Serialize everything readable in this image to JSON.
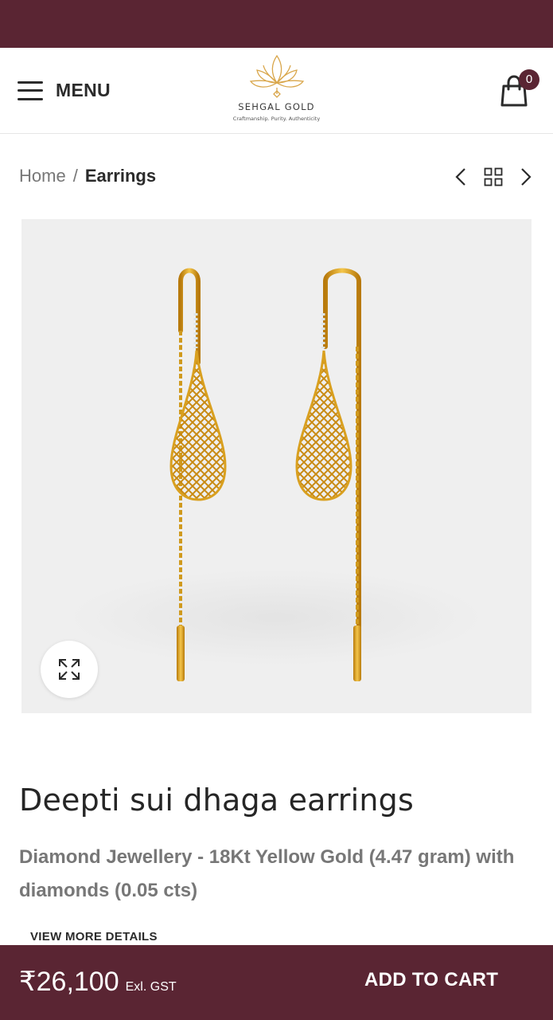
{
  "header": {
    "menu_label": "MENU",
    "logo_name": "SEHGAL GOLD",
    "logo_tagline": "Craftmanship. Purity. Authenticity",
    "cart_count": "0"
  },
  "breadcrumb": {
    "home": "Home",
    "separator": "/",
    "current": "Earrings"
  },
  "product": {
    "title": "Deepti sui dhaga earrings",
    "description": "Diamond Jewellery - 18Kt Yellow Gold (4.47 gram) with diamonds (0.05 cts)",
    "view_more": "VIEW MORE DETAILS"
  },
  "purchase_bar": {
    "price": "₹26,100",
    "tax_note": "Exl. GST",
    "add_to_cart": "ADD TO CART"
  },
  "icons": [
    "hamburger-icon",
    "lotus-logo-icon",
    "shopping-bag-icon",
    "chevron-left-icon",
    "grid-icon",
    "chevron-right-icon",
    "expand-icon"
  ],
  "colors": {
    "brand_maroon": "#5a2533",
    "gold": "#e0a626",
    "image_bg": "#efefef"
  }
}
